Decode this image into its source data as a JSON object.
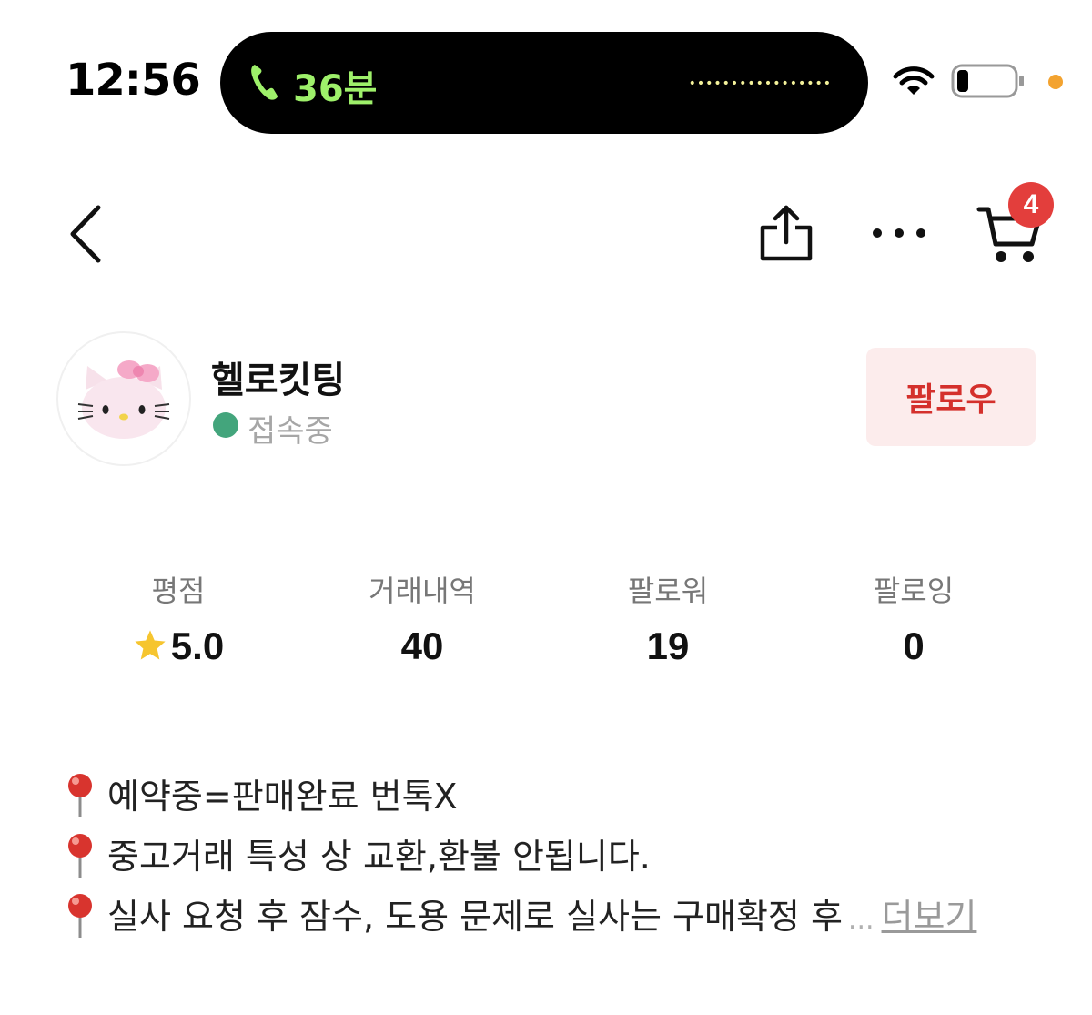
{
  "status_bar": {
    "time": "12:56",
    "call_duration": "36분",
    "icons": [
      "phone-icon",
      "wifi-icon",
      "battery-icon"
    ],
    "call_color": "#9ef06a",
    "privacy_dot_color": "#f3a330"
  },
  "nav": {
    "icons": [
      "back-icon",
      "share-icon",
      "more-icon",
      "cart-icon"
    ],
    "cart_badge": "4",
    "badge_color": "#e33e3c"
  },
  "profile": {
    "name": "헬로킷팅",
    "status": "접속중",
    "status_color": "#43a57c",
    "follow_label": "팔로우",
    "follow_color": "#d4302c"
  },
  "stats": [
    {
      "label": "평점",
      "value": "5.0",
      "icon": "star-icon"
    },
    {
      "label": "거래내역",
      "value": "40"
    },
    {
      "label": "팔로워",
      "value": "19"
    },
    {
      "label": "팔로잉",
      "value": "0"
    }
  ],
  "bio": {
    "lines": [
      "예약중=판매완료 번톡X",
      "중고거래 특성 상 교환,환불 안됩니다.",
      "실사 요청 후 잠수, 도용 문제로 실사는 구매확정 후"
    ],
    "ellipsis": "...",
    "more_label": "더보기"
  }
}
